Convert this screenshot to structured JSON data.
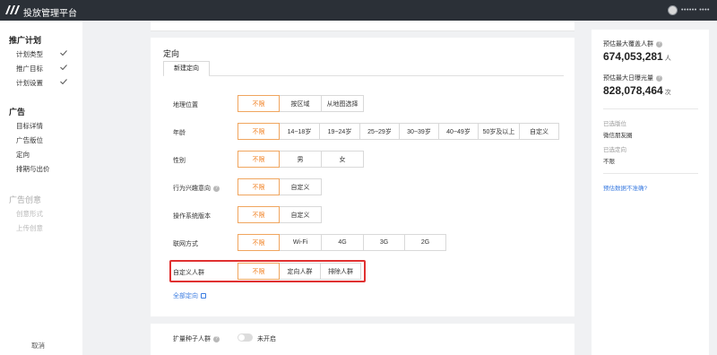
{
  "topbar": {
    "title": "投放管理平台",
    "user": "•••••• ••••"
  },
  "sidebar": {
    "group1": "推广计划",
    "group1_items": [
      "计划类型",
      "推广目标",
      "计划设置"
    ],
    "group2": "广告",
    "group2_items": [
      "目标详情",
      "广告版位",
      "定向",
      "排期与出价"
    ],
    "group3": "广告创意",
    "group3_items": [
      "创意形式",
      "上传创意"
    ],
    "cancel": "取消"
  },
  "main": {
    "section_title": "定向",
    "tab_label": "新建定向",
    "rows": [
      {
        "label": "地理位置",
        "help": false,
        "options": [
          "不限",
          "按区域",
          "从地图选择"
        ],
        "active": 0
      },
      {
        "label": "年龄",
        "help": false,
        "options": [
          "不限",
          "14~18岁",
          "19~24岁",
          "25~29岁",
          "30~39岁",
          "40~49岁",
          "50岁及以上",
          "自定义"
        ],
        "active": 0
      },
      {
        "label": "性别",
        "help": false,
        "options": [
          "不限",
          "男",
          "女"
        ],
        "active": 0
      },
      {
        "label": "行为兴趣意向",
        "help": true,
        "options": [
          "不限",
          "自定义"
        ],
        "active": 0
      },
      {
        "label": "操作系统版本",
        "help": false,
        "options": [
          "不限",
          "自定义"
        ],
        "active": 0
      },
      {
        "label": "联网方式",
        "help": false,
        "options": [
          "不限",
          "Wi-Fi",
          "4G",
          "3G",
          "2G"
        ],
        "active": 0
      },
      {
        "label": "自定义人群",
        "help": false,
        "options": [
          "不限",
          "定向人群",
          "排除人群"
        ],
        "active": 0
      }
    ],
    "all_targeting_link": "全部定向",
    "expand_label": "扩量种子人群",
    "expand_toggle_text": "未开启"
  },
  "right": {
    "reach_label": "预估最大覆盖人群",
    "reach_value": "674,053,281",
    "reach_unit": "人",
    "exposure_label": "预估最大日曝光量",
    "exposure_value": "828,078,464",
    "exposure_unit": "次",
    "placement_label": "已选版位",
    "placement_value": "微信朋友圈",
    "targeting_label": "已选定向",
    "targeting_value": "不限",
    "inaccurate_link": "预估数据不准确?"
  },
  "colors": {
    "accent": "#f07c1a",
    "highlight": "#e03131",
    "link": "#3a7be0",
    "topbar": "#2b3037"
  },
  "icons": [
    "logo-icon",
    "avatar",
    "check-icon",
    "help-icon",
    "link-icon"
  ]
}
